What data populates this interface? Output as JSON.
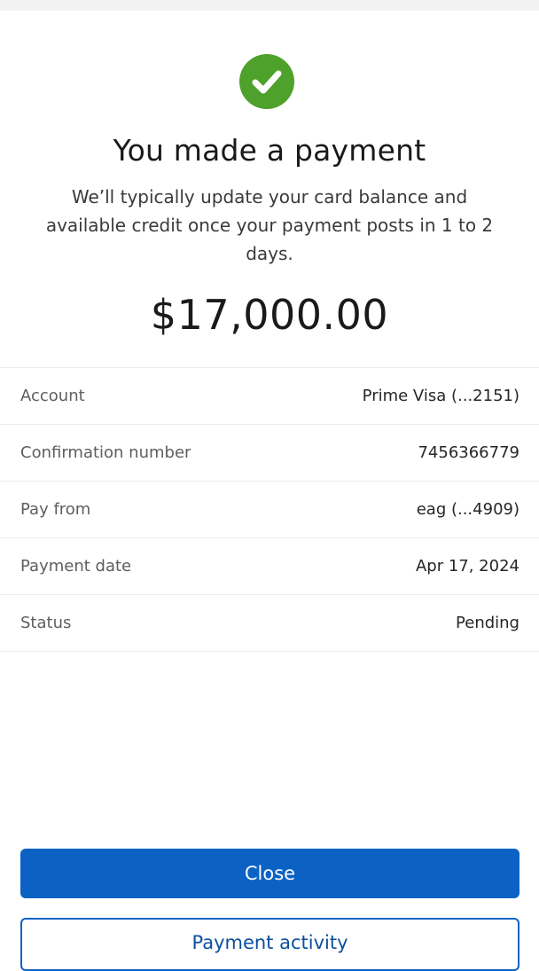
{
  "colors": {
    "success": "#4ea12a",
    "primary": "#0b62c4",
    "divider": "#ececec"
  },
  "confirmation": {
    "icon": "check-circle-icon",
    "title": "You made a payment",
    "subtitle": "We’ll typically update your card balance and available credit once your payment posts in 1 to 2 days.",
    "amount": "$17,000.00"
  },
  "details": [
    {
      "label": "Account",
      "value": "Prime Visa (...2151)"
    },
    {
      "label": "Confirmation number",
      "value": "7456366779"
    },
    {
      "label": "Pay from",
      "value": "eag (...4909)"
    },
    {
      "label": "Payment date",
      "value": "Apr 17, 2024"
    },
    {
      "label": "Status",
      "value": "Pending"
    }
  ],
  "actions": {
    "close_label": "Close",
    "payment_activity_label": "Payment activity"
  }
}
